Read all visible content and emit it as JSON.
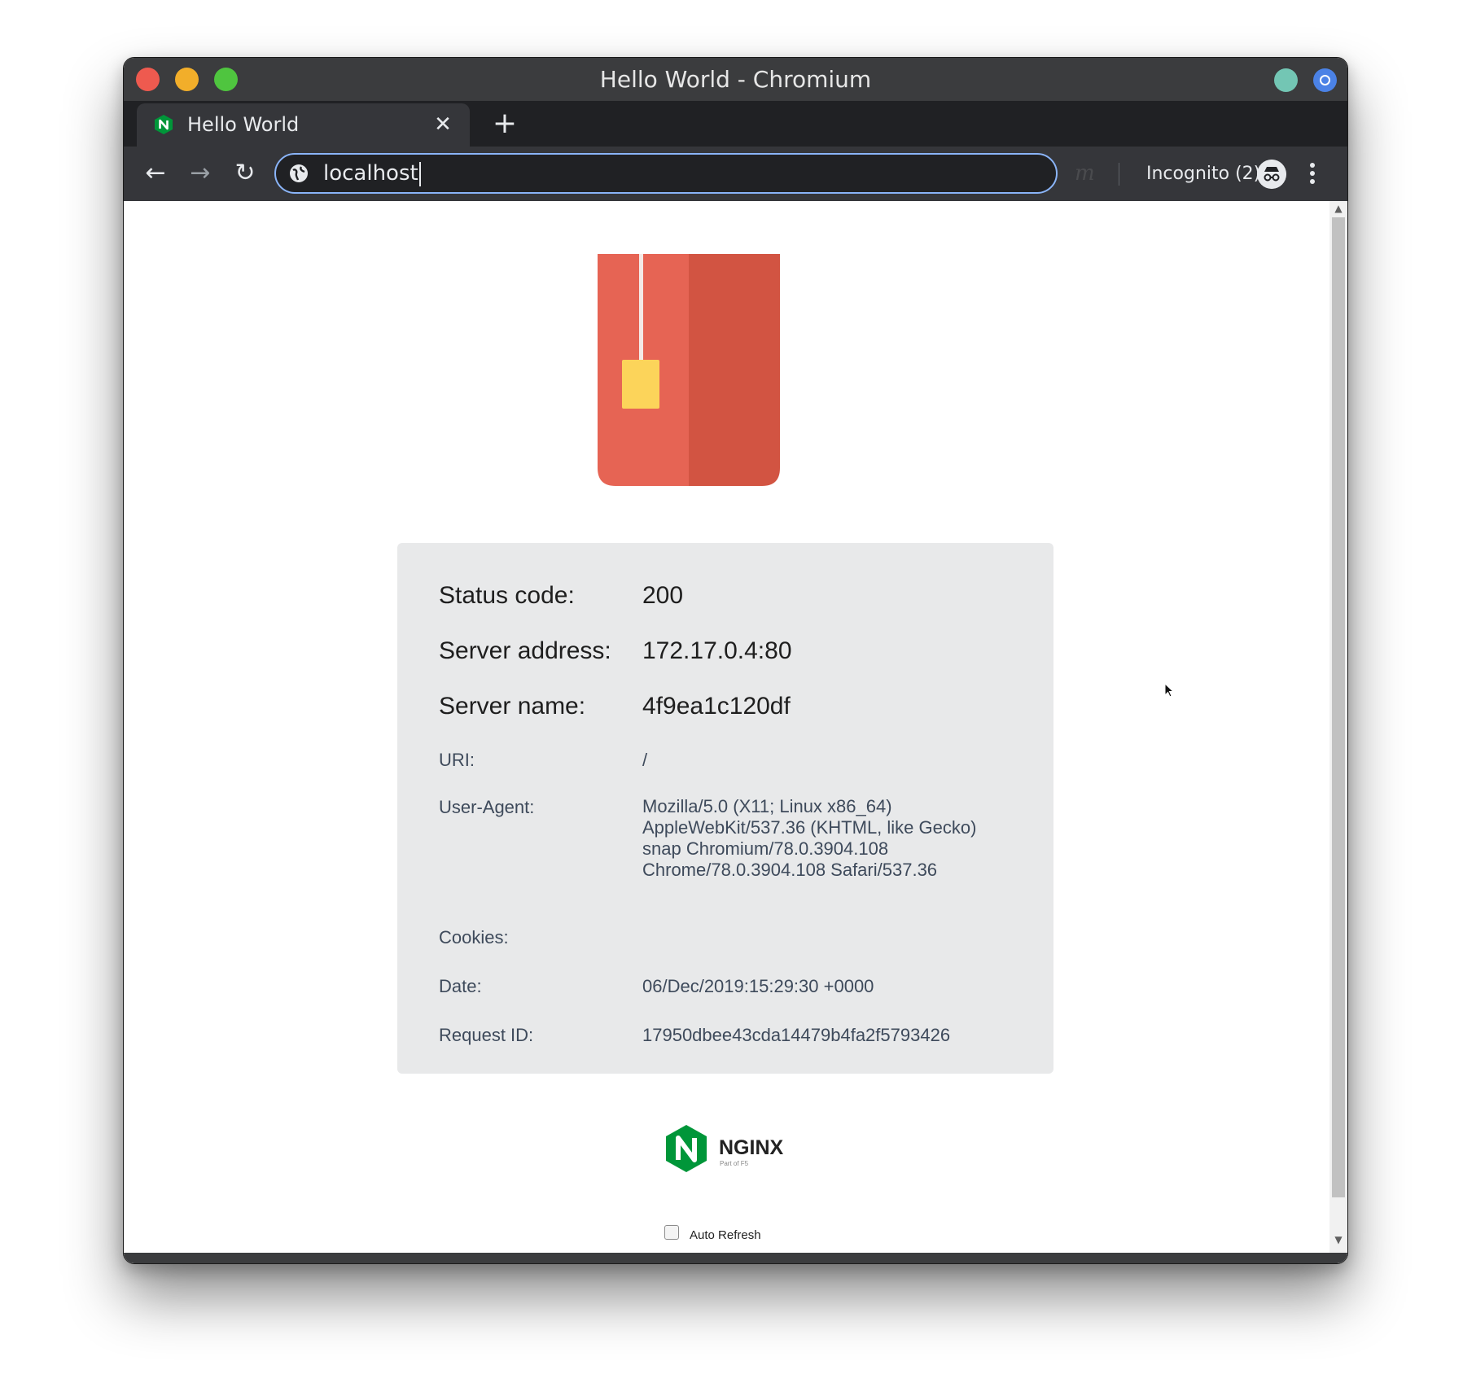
{
  "window": {
    "title": "Hello World - Chromium"
  },
  "tab": {
    "title": "Hello World",
    "favicon_icon": "nginx-n-icon",
    "close_glyph": "✕",
    "new_tab_glyph": "+"
  },
  "toolbar": {
    "back_glyph": "←",
    "forward_glyph": "→",
    "reload_glyph": "↻",
    "url": "localhost",
    "extension_glyph": "m",
    "incognito_label": "Incognito (2)"
  },
  "page": {
    "rows_big": [
      {
        "label": "Status code:",
        "value": "200"
      },
      {
        "label": "Server address:",
        "value": "172.17.0.4:80"
      },
      {
        "label": "Server name:",
        "value": "4f9ea1c120df"
      }
    ],
    "uri": {
      "label": "URI:",
      "value": "/"
    },
    "user_agent": {
      "label": "User-Agent:",
      "lines": [
        "Mozilla/5.0 (X11; Linux x86_64)",
        "AppleWebKit/537.36 (KHTML, like Gecko)",
        "snap Chromium/78.0.3904.108",
        "Chrome/78.0.3904.108 Safari/537.36"
      ]
    },
    "cookies": {
      "label": "Cookies:",
      "value": ""
    },
    "date": {
      "label": "Date:",
      "value": "06/Dec/2019:15:29:30 +0000"
    },
    "request_id": {
      "label": "Request ID:",
      "value": "17950dbee43cda14479b4fa2f5793426"
    },
    "logo": {
      "wordmark": "NGINX",
      "tagline": "Part of F5"
    },
    "auto_refresh": {
      "label": "Auto Refresh",
      "checked": false
    }
  },
  "colors": {
    "mug_light": "#e66454",
    "mug_dark": "#d25442",
    "tea_tag": "#fcd45a",
    "nginx_green": "#009639",
    "panel_bg": "#e8e9ea"
  }
}
